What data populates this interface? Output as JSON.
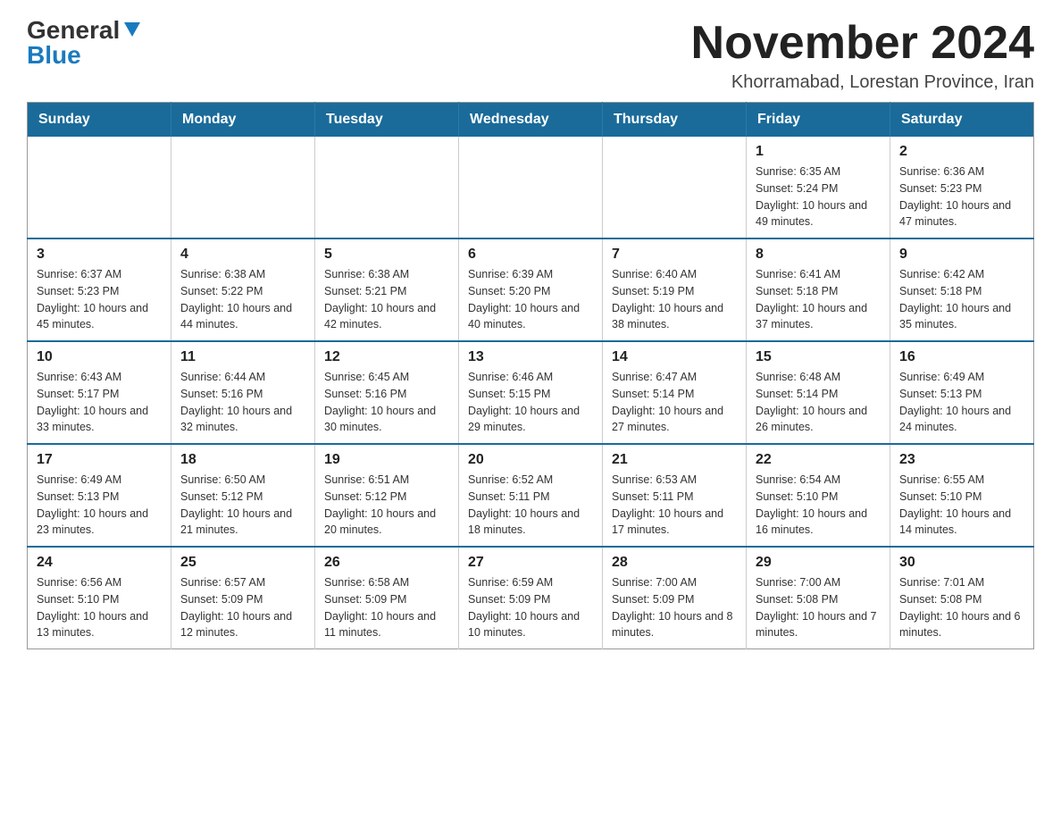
{
  "logo": {
    "general": "General",
    "blue": "Blue",
    "arrow": "▶"
  },
  "title": "November 2024",
  "subtitle": "Khorramabad, Lorestan Province, Iran",
  "weekdays": [
    "Sunday",
    "Monday",
    "Tuesday",
    "Wednesday",
    "Thursday",
    "Friday",
    "Saturday"
  ],
  "weeks": [
    [
      {
        "day": "",
        "sunrise": "",
        "sunset": "",
        "daylight": ""
      },
      {
        "day": "",
        "sunrise": "",
        "sunset": "",
        "daylight": ""
      },
      {
        "day": "",
        "sunrise": "",
        "sunset": "",
        "daylight": ""
      },
      {
        "day": "",
        "sunrise": "",
        "sunset": "",
        "daylight": ""
      },
      {
        "day": "",
        "sunrise": "",
        "sunset": "",
        "daylight": ""
      },
      {
        "day": "1",
        "sunrise": "Sunrise: 6:35 AM",
        "sunset": "Sunset: 5:24 PM",
        "daylight": "Daylight: 10 hours and 49 minutes."
      },
      {
        "day": "2",
        "sunrise": "Sunrise: 6:36 AM",
        "sunset": "Sunset: 5:23 PM",
        "daylight": "Daylight: 10 hours and 47 minutes."
      }
    ],
    [
      {
        "day": "3",
        "sunrise": "Sunrise: 6:37 AM",
        "sunset": "Sunset: 5:23 PM",
        "daylight": "Daylight: 10 hours and 45 minutes."
      },
      {
        "day": "4",
        "sunrise": "Sunrise: 6:38 AM",
        "sunset": "Sunset: 5:22 PM",
        "daylight": "Daylight: 10 hours and 44 minutes."
      },
      {
        "day": "5",
        "sunrise": "Sunrise: 6:38 AM",
        "sunset": "Sunset: 5:21 PM",
        "daylight": "Daylight: 10 hours and 42 minutes."
      },
      {
        "day": "6",
        "sunrise": "Sunrise: 6:39 AM",
        "sunset": "Sunset: 5:20 PM",
        "daylight": "Daylight: 10 hours and 40 minutes."
      },
      {
        "day": "7",
        "sunrise": "Sunrise: 6:40 AM",
        "sunset": "Sunset: 5:19 PM",
        "daylight": "Daylight: 10 hours and 38 minutes."
      },
      {
        "day": "8",
        "sunrise": "Sunrise: 6:41 AM",
        "sunset": "Sunset: 5:18 PM",
        "daylight": "Daylight: 10 hours and 37 minutes."
      },
      {
        "day": "9",
        "sunrise": "Sunrise: 6:42 AM",
        "sunset": "Sunset: 5:18 PM",
        "daylight": "Daylight: 10 hours and 35 minutes."
      }
    ],
    [
      {
        "day": "10",
        "sunrise": "Sunrise: 6:43 AM",
        "sunset": "Sunset: 5:17 PM",
        "daylight": "Daylight: 10 hours and 33 minutes."
      },
      {
        "day": "11",
        "sunrise": "Sunrise: 6:44 AM",
        "sunset": "Sunset: 5:16 PM",
        "daylight": "Daylight: 10 hours and 32 minutes."
      },
      {
        "day": "12",
        "sunrise": "Sunrise: 6:45 AM",
        "sunset": "Sunset: 5:16 PM",
        "daylight": "Daylight: 10 hours and 30 minutes."
      },
      {
        "day": "13",
        "sunrise": "Sunrise: 6:46 AM",
        "sunset": "Sunset: 5:15 PM",
        "daylight": "Daylight: 10 hours and 29 minutes."
      },
      {
        "day": "14",
        "sunrise": "Sunrise: 6:47 AM",
        "sunset": "Sunset: 5:14 PM",
        "daylight": "Daylight: 10 hours and 27 minutes."
      },
      {
        "day": "15",
        "sunrise": "Sunrise: 6:48 AM",
        "sunset": "Sunset: 5:14 PM",
        "daylight": "Daylight: 10 hours and 26 minutes."
      },
      {
        "day": "16",
        "sunrise": "Sunrise: 6:49 AM",
        "sunset": "Sunset: 5:13 PM",
        "daylight": "Daylight: 10 hours and 24 minutes."
      }
    ],
    [
      {
        "day": "17",
        "sunrise": "Sunrise: 6:49 AM",
        "sunset": "Sunset: 5:13 PM",
        "daylight": "Daylight: 10 hours and 23 minutes."
      },
      {
        "day": "18",
        "sunrise": "Sunrise: 6:50 AM",
        "sunset": "Sunset: 5:12 PM",
        "daylight": "Daylight: 10 hours and 21 minutes."
      },
      {
        "day": "19",
        "sunrise": "Sunrise: 6:51 AM",
        "sunset": "Sunset: 5:12 PM",
        "daylight": "Daylight: 10 hours and 20 minutes."
      },
      {
        "day": "20",
        "sunrise": "Sunrise: 6:52 AM",
        "sunset": "Sunset: 5:11 PM",
        "daylight": "Daylight: 10 hours and 18 minutes."
      },
      {
        "day": "21",
        "sunrise": "Sunrise: 6:53 AM",
        "sunset": "Sunset: 5:11 PM",
        "daylight": "Daylight: 10 hours and 17 minutes."
      },
      {
        "day": "22",
        "sunrise": "Sunrise: 6:54 AM",
        "sunset": "Sunset: 5:10 PM",
        "daylight": "Daylight: 10 hours and 16 minutes."
      },
      {
        "day": "23",
        "sunrise": "Sunrise: 6:55 AM",
        "sunset": "Sunset: 5:10 PM",
        "daylight": "Daylight: 10 hours and 14 minutes."
      }
    ],
    [
      {
        "day": "24",
        "sunrise": "Sunrise: 6:56 AM",
        "sunset": "Sunset: 5:10 PM",
        "daylight": "Daylight: 10 hours and 13 minutes."
      },
      {
        "day": "25",
        "sunrise": "Sunrise: 6:57 AM",
        "sunset": "Sunset: 5:09 PM",
        "daylight": "Daylight: 10 hours and 12 minutes."
      },
      {
        "day": "26",
        "sunrise": "Sunrise: 6:58 AM",
        "sunset": "Sunset: 5:09 PM",
        "daylight": "Daylight: 10 hours and 11 minutes."
      },
      {
        "day": "27",
        "sunrise": "Sunrise: 6:59 AM",
        "sunset": "Sunset: 5:09 PM",
        "daylight": "Daylight: 10 hours and 10 minutes."
      },
      {
        "day": "28",
        "sunrise": "Sunrise: 7:00 AM",
        "sunset": "Sunset: 5:09 PM",
        "daylight": "Daylight: 10 hours and 8 minutes."
      },
      {
        "day": "29",
        "sunrise": "Sunrise: 7:00 AM",
        "sunset": "Sunset: 5:08 PM",
        "daylight": "Daylight: 10 hours and 7 minutes."
      },
      {
        "day": "30",
        "sunrise": "Sunrise: 7:01 AM",
        "sunset": "Sunset: 5:08 PM",
        "daylight": "Daylight: 10 hours and 6 minutes."
      }
    ]
  ]
}
